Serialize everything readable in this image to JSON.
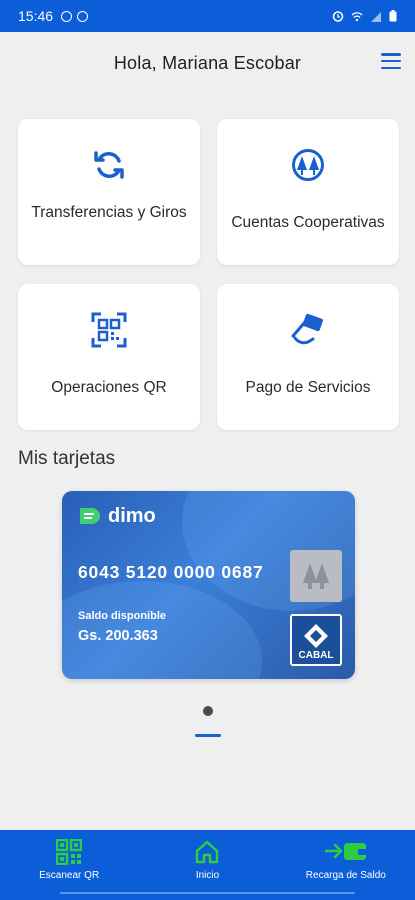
{
  "status_bar": {
    "time": "15:46",
    "icons_left": [
      "navigation-icon",
      "notification-icon"
    ],
    "icons_right": [
      "alarm-icon",
      "wifi-icon",
      "signal-icon",
      "battery-icon"
    ]
  },
  "header": {
    "greeting": "Hola, Mariana Escobar",
    "menu_icon": "hamburger-menu-icon"
  },
  "tiles": [
    {
      "label": "Transferencias y Giros",
      "icon": "refresh-arrows-icon"
    },
    {
      "label": "Cuentas Cooperativas",
      "icon": "cooperative-pines-icon"
    },
    {
      "label": "Operaciones QR",
      "icon": "qr-scan-icon"
    },
    {
      "label": "Pago de Servicios",
      "icon": "card-payment-icon"
    }
  ],
  "cards_section": {
    "title": "Mis tarjetas",
    "card": {
      "brand": "dimo",
      "number": "6043 5120 0000 0687",
      "balance_label": "Saldo disponible",
      "balance": "Gs. 200.363",
      "network": "CABAL"
    },
    "page_count": 1,
    "current_page": 1
  },
  "bottom_nav": [
    {
      "label": "Escanear QR",
      "icon": "qr-code-icon"
    },
    {
      "label": "Inicio",
      "icon": "home-icon"
    },
    {
      "label": "Recarga de Saldo",
      "icon": "wallet-arrow-icon"
    }
  ],
  "colors": {
    "primary": "#0b5ed7",
    "accent": "#1a5fd0",
    "nav_icon": "#2ecc40",
    "background": "#efefef"
  }
}
